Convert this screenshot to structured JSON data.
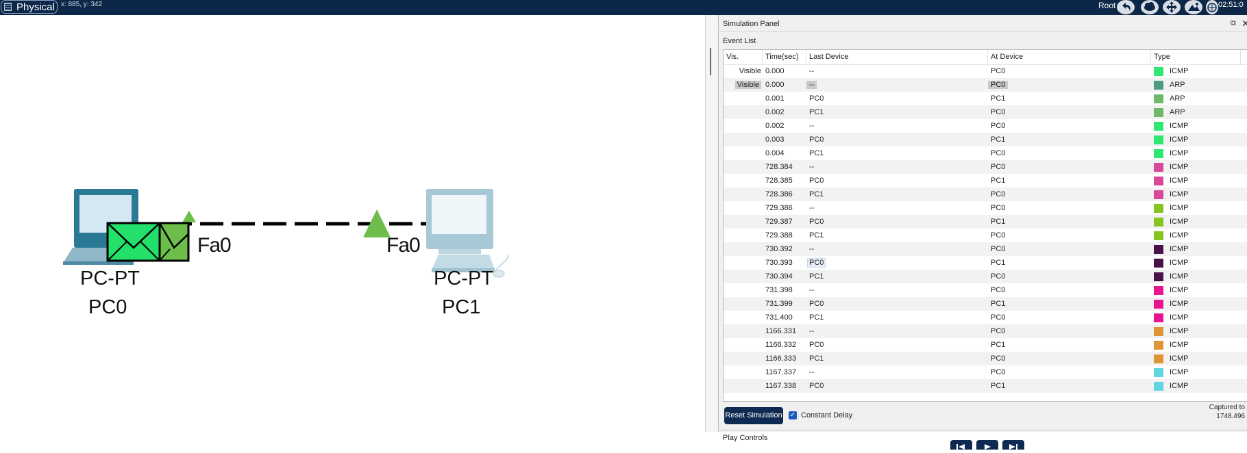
{
  "topbar": {
    "mode_label": "Physical",
    "coords": "x: 885, y: 342",
    "root_label": "Root",
    "clock": "02:51:0",
    "icons": [
      "undo-icon",
      "cloud-icon",
      "move-icon",
      "landscape-icon",
      "globe-icon"
    ]
  },
  "workspace": {
    "devices": [
      {
        "model": "PC-PT",
        "name": "PC0",
        "port": "Fa0"
      },
      {
        "model": "PC-PT",
        "name": "PC1",
        "port": "Fa0"
      }
    ],
    "link_status_color": "#6cbd4a",
    "pdu_color": "#22e06a"
  },
  "sim_panel": {
    "title": "Simulation Panel",
    "event_list_title": "Event List",
    "columns": [
      "Vis.",
      "Time(sec)",
      "Last Device",
      "At Device",
      "Type"
    ],
    "events": [
      {
        "vis": "Visible",
        "time": "0.000",
        "last": "--",
        "at": "PC0",
        "color": "#2ee86f",
        "type": "ICMP"
      },
      {
        "vis": "Visible",
        "time": "0.000",
        "last": "--",
        "at": "PC0",
        "color": "#4f9a83",
        "type": "ARP"
      },
      {
        "vis": "",
        "time": "0.001",
        "last": "PC0",
        "at": "PC1",
        "color": "#6db86a",
        "type": "ARP"
      },
      {
        "vis": "",
        "time": "0.002",
        "last": "PC1",
        "at": "PC0",
        "color": "#6db86a",
        "type": "ARP"
      },
      {
        "vis": "",
        "time": "0.002",
        "last": "--",
        "at": "PC0",
        "color": "#2ee86f",
        "type": "ICMP"
      },
      {
        "vis": "",
        "time": "0.003",
        "last": "PC0",
        "at": "PC1",
        "color": "#2ee86f",
        "type": "ICMP"
      },
      {
        "vis": "",
        "time": "0.004",
        "last": "PC1",
        "at": "PC0",
        "color": "#2ee86f",
        "type": "ICMP"
      },
      {
        "vis": "",
        "time": "728.384",
        "last": "--",
        "at": "PC0",
        "color": "#d9489b",
        "type": "ICMP"
      },
      {
        "vis": "",
        "time": "728.385",
        "last": "PC0",
        "at": "PC1",
        "color": "#d9489b",
        "type": "ICMP"
      },
      {
        "vis": "",
        "time": "728.386",
        "last": "PC1",
        "at": "PC0",
        "color": "#d9489b",
        "type": "ICMP"
      },
      {
        "vis": "",
        "time": "729.386",
        "last": "--",
        "at": "PC0",
        "color": "#86c41f",
        "type": "ICMP"
      },
      {
        "vis": "",
        "time": "729.387",
        "last": "PC0",
        "at": "PC1",
        "color": "#86c41f",
        "type": "ICMP"
      },
      {
        "vis": "",
        "time": "729.388",
        "last": "PC1",
        "at": "PC0",
        "color": "#86c41f",
        "type": "ICMP"
      },
      {
        "vis": "",
        "time": "730.392",
        "last": "--",
        "at": "PC0",
        "color": "#4a1248",
        "type": "ICMP"
      },
      {
        "vis": "",
        "time": "730.393",
        "last": "PC0",
        "at": "PC1",
        "color": "#4a1248",
        "type": "ICMP"
      },
      {
        "vis": "",
        "time": "730.394",
        "last": "PC1",
        "at": "PC0",
        "color": "#4a1248",
        "type": "ICMP"
      },
      {
        "vis": "",
        "time": "731.398",
        "last": "--",
        "at": "PC0",
        "color": "#ea1490",
        "type": "ICMP"
      },
      {
        "vis": "",
        "time": "731.399",
        "last": "PC0",
        "at": "PC1",
        "color": "#ea1490",
        "type": "ICMP"
      },
      {
        "vis": "",
        "time": "731.400",
        "last": "PC1",
        "at": "PC0",
        "color": "#ea1490",
        "type": "ICMP"
      },
      {
        "vis": "",
        "time": "1166.331",
        "last": "--",
        "at": "PC0",
        "color": "#df9436",
        "type": "ICMP"
      },
      {
        "vis": "",
        "time": "1166.332",
        "last": "PC0",
        "at": "PC1",
        "color": "#df9436",
        "type": "ICMP"
      },
      {
        "vis": "",
        "time": "1166.333",
        "last": "PC1",
        "at": "PC0",
        "color": "#df9436",
        "type": "ICMP"
      },
      {
        "vis": "",
        "time": "1167.337",
        "last": "--",
        "at": "PC0",
        "color": "#5fd5df",
        "type": "ICMP"
      },
      {
        "vis": "",
        "time": "1167.338",
        "last": "PC0",
        "at": "PC1",
        "color": "#5fd5df",
        "type": "ICMP"
      }
    ],
    "reset_label": "Reset Simulation",
    "constant_delay_label": "Constant Delay",
    "constant_delay_checked": true,
    "captured_label": "Captured to",
    "captured_value": "1748.496",
    "play_controls_title": "Play Controls",
    "play_buttons": [
      "back-icon",
      "play-icon",
      "forward-icon"
    ]
  }
}
